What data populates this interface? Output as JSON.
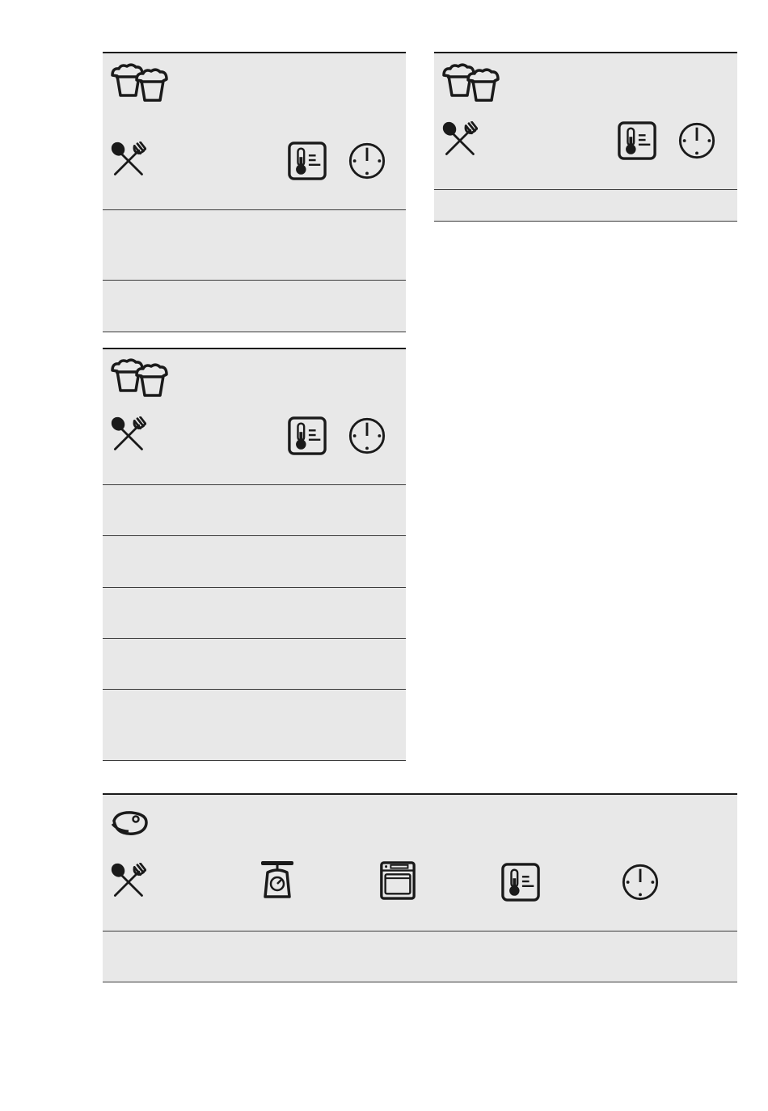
{
  "icons": {
    "cakes": "cupcakes-icon",
    "meat": "steak-icon",
    "food": "spoon-fork-icon",
    "temperature": "thermometer-icon",
    "time": "clock-icon",
    "weight": "kitchen-scale-icon",
    "oven": "oven-icon"
  },
  "colors": {
    "row_fill": "#e8e8e8",
    "rule": "#3a3a3a",
    "icon": "#1a1a1a"
  }
}
